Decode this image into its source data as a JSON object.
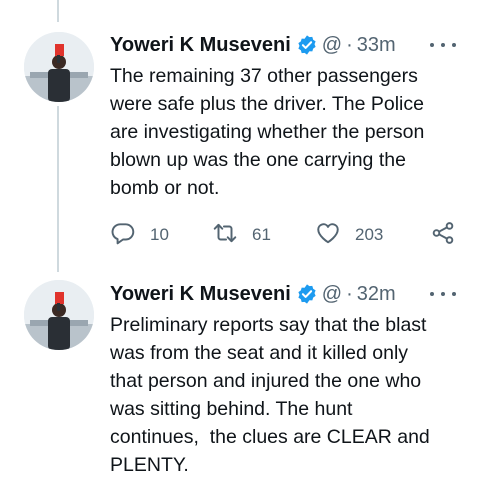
{
  "tweets": [
    {
      "author": "Yoweri K Museveni",
      "handle": "@",
      "separator": "·",
      "time": "33m",
      "text": "The remaining 37 other passengers\nwere safe plus the driver. The Police\nare investigating whether the person\nblown up was the one carrying the\nbomb or not.",
      "replies": "10",
      "retweets": "61",
      "likes": "203"
    },
    {
      "author": "Yoweri K Museveni",
      "handle": "@",
      "separator": "·",
      "time": "32m",
      "text": "Preliminary reports say that the blast\nwas from the seat and it killed only\nthat person and injured the one who\nwas sitting behind. The hunt\ncontinues,  the clues are CLEAR and\nPLENTY."
    }
  ],
  "colors": {
    "text": "#0f1419",
    "secondary": "#536471",
    "verified": "#1d9bf0",
    "thread_line": "#cfd9de"
  },
  "icons": [
    "verified-badge-icon",
    "more-icon",
    "reply-icon",
    "retweet-icon",
    "like-icon",
    "share-icon"
  ]
}
